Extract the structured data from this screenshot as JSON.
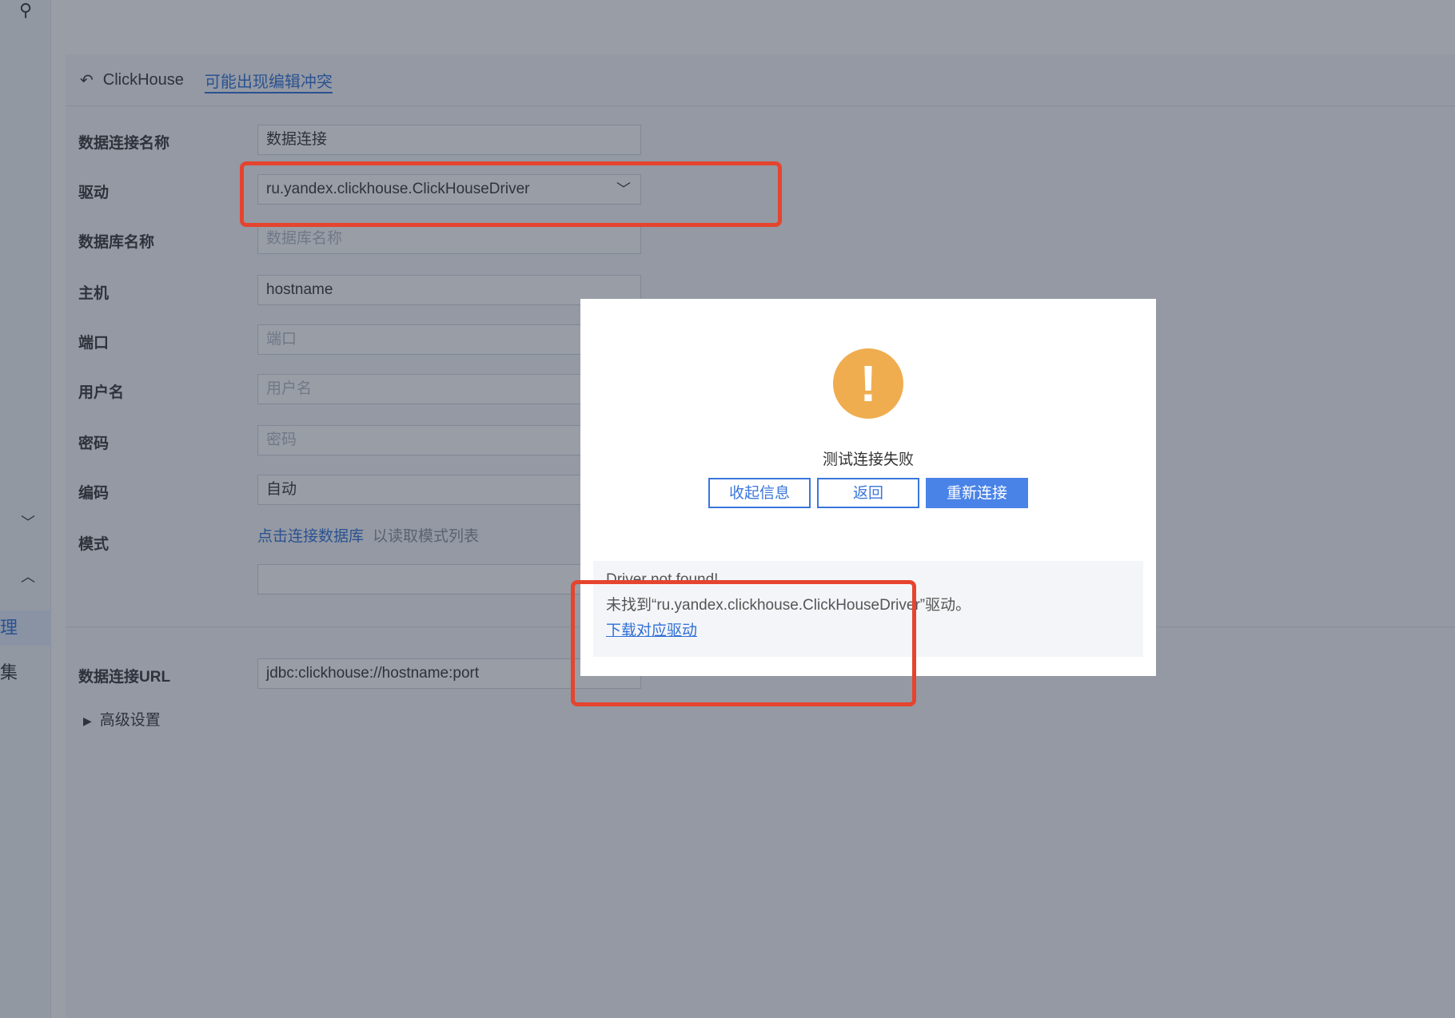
{
  "sidebar": {
    "pin_icon": "unpin-icon",
    "items": [
      {
        "label": "理",
        "active": true
      },
      {
        "label": "集",
        "active": false
      }
    ]
  },
  "header": {
    "title": "ClickHouse",
    "conflict_link": "可能出现编辑冲突"
  },
  "form": {
    "connection_name": {
      "label": "数据连接名称",
      "value": "数据连接"
    },
    "driver": {
      "label": "驱动",
      "value": "ru.yandex.clickhouse.ClickHouseDriver"
    },
    "database_name": {
      "label": "数据库名称",
      "placeholder": "数据库名称"
    },
    "host": {
      "label": "主机",
      "value": "hostname"
    },
    "port": {
      "label": "端口",
      "placeholder": "端口"
    },
    "username": {
      "label": "用户名",
      "placeholder": "用户名"
    },
    "password": {
      "label": "密码",
      "placeholder": "密码"
    },
    "encoding": {
      "label": "编码",
      "value": "自动"
    },
    "schema": {
      "label": "模式",
      "link": "点击连接数据库",
      "hint": "以读取模式列表"
    },
    "url": {
      "label": "数据连接URL",
      "value": "jdbc:clickhouse://hostname:port"
    },
    "advanced": "高级设置"
  },
  "dialog": {
    "title": "测试连接失败",
    "buttons": {
      "collapse": "收起信息",
      "back": "返回",
      "reconnect": "重新连接"
    },
    "error": {
      "line1": "Driver not found!",
      "line2": "未找到“ru.yandex.clickhouse.ClickHouseDriver”驱动。",
      "link": "下载对应驱动"
    }
  },
  "colors": {
    "accent": "#2f6fd6",
    "warning": "#efad4f",
    "highlight": "#e5442f"
  }
}
